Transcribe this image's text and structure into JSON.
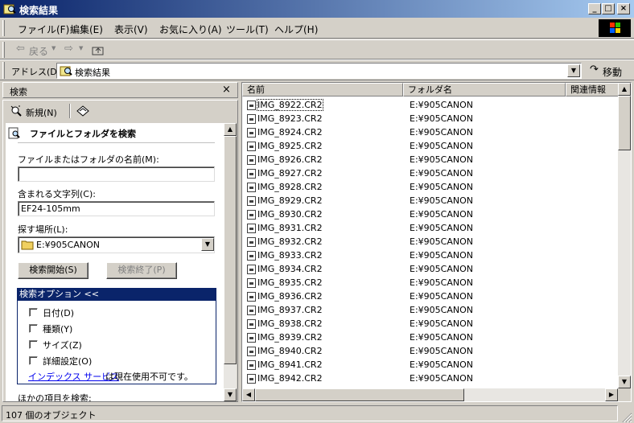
{
  "window": {
    "title": "検索結果"
  },
  "menu": {
    "items": [
      "ファイル(F)",
      "編集(E)",
      "表示(V)",
      "お気に入り(A)",
      "ツール(T)",
      "ヘルプ(H)"
    ]
  },
  "toolbar": {
    "back_label": "戻る"
  },
  "address": {
    "label": "アドレス(D)",
    "value": "検索結果",
    "go_label": "移動"
  },
  "search_pane": {
    "title": "検索",
    "new_label": "新規(N)",
    "heading": "ファイルとフォルダを検索",
    "name_label": "ファイルまたはフォルダの名前(M):",
    "name_value": "",
    "text_label": "含まれる文字列(C):",
    "text_value": "EF24-105mm",
    "location_label": "探す場所(L):",
    "location_value": "E:¥905CANON",
    "start_button": "検索開始(S)",
    "stop_button": "検索終了(P)",
    "options_title": "検索オプション  <<",
    "options": [
      "日付(D)",
      "種類(Y)",
      "サイズ(Z)",
      "詳細設定(O)"
    ],
    "index_link": "インデックス サービス",
    "index_text": "は現在使用不可です。",
    "other_label": "ほかの項目を検索:"
  },
  "results": {
    "columns": [
      "名前",
      "フォルダ名",
      "関連情報"
    ],
    "rows": [
      {
        "name": "IMG_8922.CR2",
        "folder": "E:¥905CANON"
      },
      {
        "name": "IMG_8923.CR2",
        "folder": "E:¥905CANON"
      },
      {
        "name": "IMG_8924.CR2",
        "folder": "E:¥905CANON"
      },
      {
        "name": "IMG_8925.CR2",
        "folder": "E:¥905CANON"
      },
      {
        "name": "IMG_8926.CR2",
        "folder": "E:¥905CANON"
      },
      {
        "name": "IMG_8927.CR2",
        "folder": "E:¥905CANON"
      },
      {
        "name": "IMG_8928.CR2",
        "folder": "E:¥905CANON"
      },
      {
        "name": "IMG_8929.CR2",
        "folder": "E:¥905CANON"
      },
      {
        "name": "IMG_8930.CR2",
        "folder": "E:¥905CANON"
      },
      {
        "name": "IMG_8931.CR2",
        "folder": "E:¥905CANON"
      },
      {
        "name": "IMG_8932.CR2",
        "folder": "E:¥905CANON"
      },
      {
        "name": "IMG_8933.CR2",
        "folder": "E:¥905CANON"
      },
      {
        "name": "IMG_8934.CR2",
        "folder": "E:¥905CANON"
      },
      {
        "name": "IMG_8935.CR2",
        "folder": "E:¥905CANON"
      },
      {
        "name": "IMG_8936.CR2",
        "folder": "E:¥905CANON"
      },
      {
        "name": "IMG_8937.CR2",
        "folder": "E:¥905CANON"
      },
      {
        "name": "IMG_8938.CR2",
        "folder": "E:¥905CANON"
      },
      {
        "name": "IMG_8939.CR2",
        "folder": "E:¥905CANON"
      },
      {
        "name": "IMG_8940.CR2",
        "folder": "E:¥905CANON"
      },
      {
        "name": "IMG_8941.CR2",
        "folder": "E:¥905CANON"
      },
      {
        "name": "IMG_8942.CR2",
        "folder": "E:¥905CANON"
      }
    ]
  },
  "status": {
    "text": "107 個のオブジェクト"
  },
  "colors": {
    "title_bar": "#0a246a",
    "face": "#d4d0c8",
    "options_header": "#0a246a",
    "link": "#0000ee"
  },
  "icons": [
    "search-folder-icon",
    "minimize-icon",
    "maximize-icon",
    "close-icon",
    "windows-logo-icon",
    "back-arrow-icon",
    "forward-arrow-icon",
    "up-folder-icon",
    "go-arrow-icon",
    "new-search-icon",
    "folder-icon",
    "file-icon"
  ]
}
